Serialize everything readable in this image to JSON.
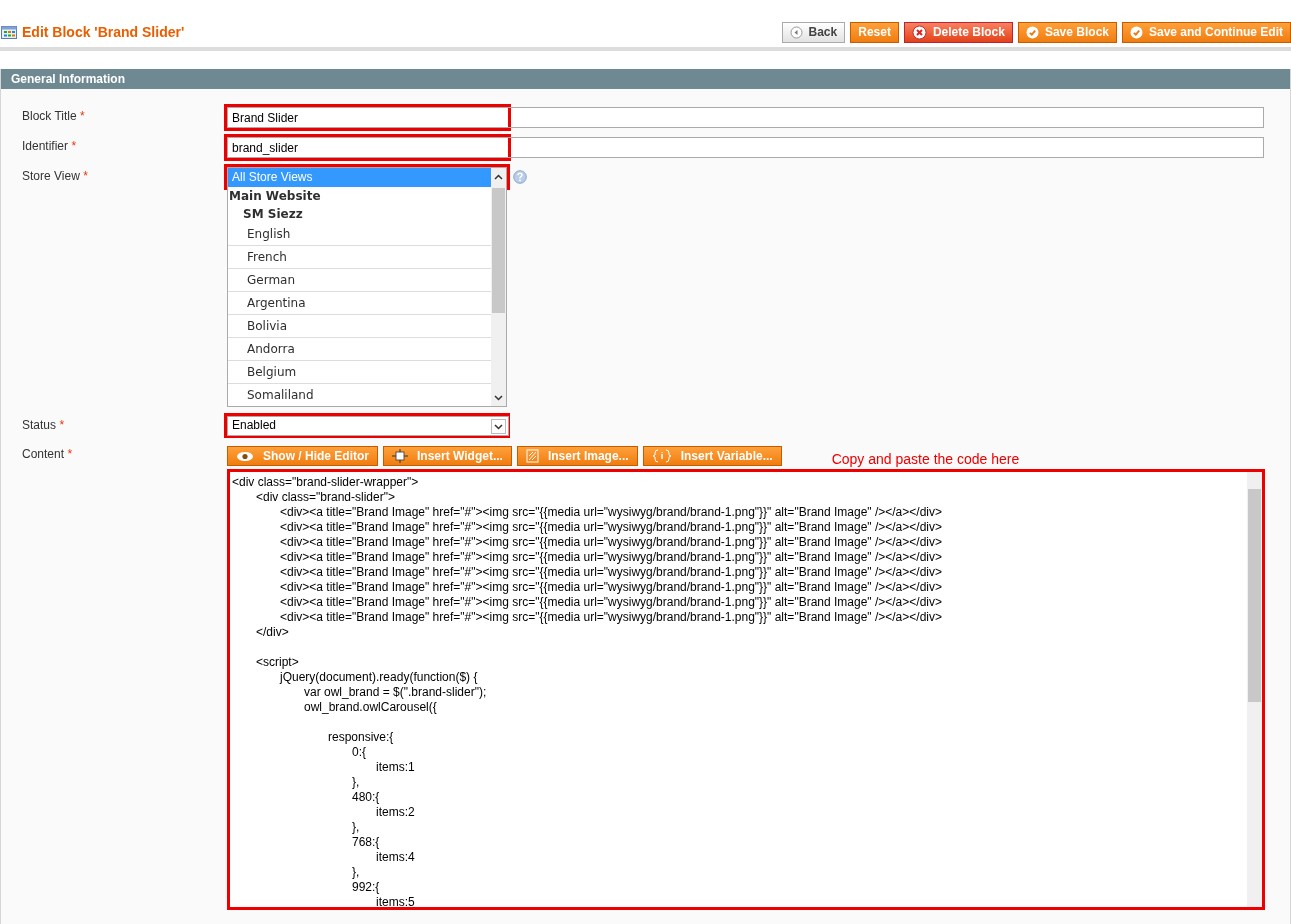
{
  "page_title": "Edit Block 'Brand Slider'",
  "buttons": [
    {
      "label": "Back",
      "kind": "back"
    },
    {
      "label": "Reset",
      "kind": "plain"
    },
    {
      "label": "Delete Block",
      "kind": "delete"
    },
    {
      "label": "Save Block",
      "kind": "save"
    },
    {
      "label": "Save and Continue Edit",
      "kind": "save"
    }
  ],
  "section": {
    "title": "General Information"
  },
  "fields": [
    {
      "label": "Block Title",
      "required_mark": "*",
      "value": "Brand Slider",
      "highlighted": true
    },
    {
      "label": "Identifier",
      "required_mark": "*",
      "value": "brand_slider",
      "highlighted": true
    }
  ],
  "store_view": {
    "label": "Store View",
    "required_mark": "*",
    "highlighted": true,
    "options": [
      {
        "label": "All Store Views",
        "selected": true
      }
    ],
    "groups": [
      {
        "label": "Main Website",
        "children": [
          {
            "label": "SM Siezz",
            "children": [
              {
                "label": "English",
                "selected": false
              },
              {
                "label": "French",
                "selected": false
              },
              {
                "label": "German",
                "selected": false
              },
              {
                "label": "Argentina",
                "selected": false
              },
              {
                "label": "Bolivia",
                "selected": false
              },
              {
                "label": "Andorra",
                "selected": false
              },
              {
                "label": "Belgium",
                "selected": false
              },
              {
                "label": "Somaliland",
                "selected": false
              }
            ]
          }
        ]
      }
    ]
  },
  "status": {
    "label": "Status",
    "required_mark": "*",
    "value": "Enabled",
    "highlighted": true
  },
  "content": {
    "label": "Content",
    "required_mark": "*",
    "highlighted": true,
    "annotation": "Copy and paste the code here",
    "editor_buttons": [
      {
        "label": "Show / Hide Editor",
        "kind": "eye"
      },
      {
        "label": "Insert Widget...",
        "kind": "widget"
      },
      {
        "label": "Insert Image...",
        "kind": "image"
      },
      {
        "label": "Insert Variable...",
        "kind": "variable"
      }
    ],
    "lines": [
      {
        "kind": "code",
        "text": "<div class=\"brand-slider-wrapper\">"
      },
      {
        "kind": "code",
        "text": "\t<div class=\"brand-slider\">"
      },
      {
        "kind": "code",
        "text": "\t\t<div><a title=\"Brand Image\" href=\"#\"><img src=\"{{media url=\"wysiwyg/brand/brand-1.png\"}}\" alt=\"Brand Image\" /></a></div>"
      },
      {
        "kind": "code",
        "text": "\t\t<div><a title=\"Brand Image\" href=\"#\"><img src=\"{{media url=\"wysiwyg/brand/brand-1.png\"}}\" alt=\"Brand Image\" /></a></div>"
      },
      {
        "kind": "code",
        "text": "\t\t<div><a title=\"Brand Image\" href=\"#\"><img src=\"{{media url=\"wysiwyg/brand/brand-1.png\"}}\" alt=\"Brand Image\" /></a></div>"
      },
      {
        "kind": "code",
        "text": "\t\t<div><a title=\"Brand Image\" href=\"#\"><img src=\"{{media url=\"wysiwyg/brand/brand-1.png\"}}\" alt=\"Brand Image\" /></a></div>"
      },
      {
        "kind": "code",
        "text": "\t\t<div><a title=\"Brand Image\" href=\"#\"><img src=\"{{media url=\"wysiwyg/brand/brand-1.png\"}}\" alt=\"Brand Image\" /></a></div>"
      },
      {
        "kind": "code",
        "text": "\t\t<div><a title=\"Brand Image\" href=\"#\"><img src=\"{{media url=\"wysiwyg/brand/brand-1.png\"}}\" alt=\"Brand Image\" /></a></div>"
      },
      {
        "kind": "code",
        "text": "\t\t<div><a title=\"Brand Image\" href=\"#\"><img src=\"{{media url=\"wysiwyg/brand/brand-1.png\"}}\" alt=\"Brand Image\" /></a></div>"
      },
      {
        "kind": "code",
        "text": "\t\t<div><a title=\"Brand Image\" href=\"#\"><img src=\"{{media url=\"wysiwyg/brand/brand-1.png\"}}\" alt=\"Brand Image\" /></a></div>"
      },
      {
        "kind": "code",
        "text": "\t</div>"
      },
      {
        "kind": "blank"
      },
      {
        "kind": "code",
        "text": "\t<script>"
      },
      {
        "kind": "code",
        "text": "\t\tjQuery(document).ready(function($) {"
      },
      {
        "kind": "code",
        "text": "\t\t\tvar owl_brand = $(\".brand-slider\");"
      },
      {
        "kind": "code",
        "text": "\t\t\towl_brand.owlCarousel({"
      },
      {
        "kind": "blank"
      },
      {
        "kind": "code",
        "text": "\t\t\t\tresponsive:{"
      },
      {
        "kind": "code",
        "text": "\t\t\t\t\t0:{"
      },
      {
        "kind": "code",
        "text": "\t\t\t\t\t\titems:1"
      },
      {
        "kind": "code",
        "text": "\t\t\t\t\t},"
      },
      {
        "kind": "code",
        "text": "\t\t\t\t\t480:{"
      },
      {
        "kind": "code",
        "text": "\t\t\t\t\t\titems:2"
      },
      {
        "kind": "code",
        "text": "\t\t\t\t\t},"
      },
      {
        "kind": "code",
        "text": "\t\t\t\t\t768:{"
      },
      {
        "kind": "code",
        "text": "\t\t\t\t\t\titems:4"
      },
      {
        "kind": "code",
        "text": "\t\t\t\t\t},"
      },
      {
        "kind": "code",
        "text": "\t\t\t\t\t992:{"
      },
      {
        "kind": "code",
        "text": "\t\t\t\t\t\titems:5"
      }
    ]
  }
}
